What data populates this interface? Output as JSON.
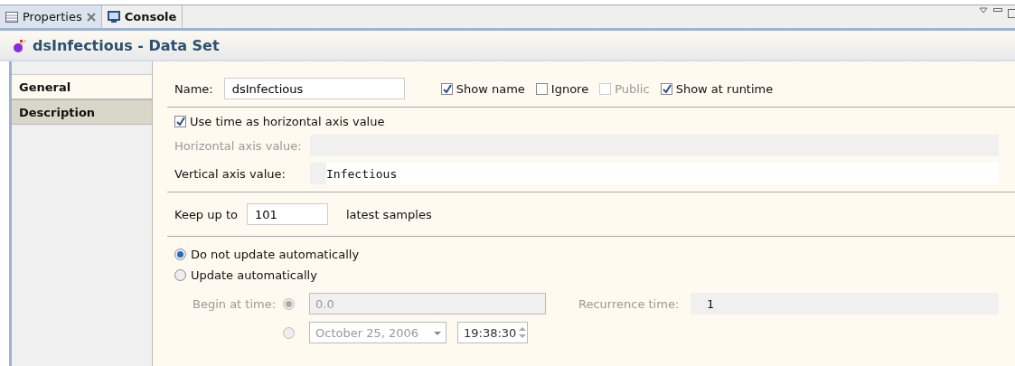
{
  "tabs": [
    {
      "label": "Properties",
      "selected": true,
      "closable": true,
      "kind": "properties"
    },
    {
      "label": "Console",
      "selected": false,
      "closable": false,
      "kind": "console"
    }
  ],
  "header": {
    "title": "dsInfectious - Data Set"
  },
  "sidebar": {
    "items": [
      {
        "label": "General",
        "selected": true
      },
      {
        "label": "Description",
        "selected": false
      }
    ]
  },
  "name_row": {
    "label": "Name:",
    "value": "dsInfectious",
    "options": [
      {
        "label": "Show name",
        "checked": true,
        "disabled": false
      },
      {
        "label": "Ignore",
        "checked": false,
        "disabled": false
      },
      {
        "label": "Public",
        "checked": false,
        "disabled": true
      },
      {
        "label": "Show at runtime",
        "checked": true,
        "disabled": false
      }
    ]
  },
  "axis": {
    "use_time": {
      "label": "Use time as horizontal axis value",
      "checked": true
    },
    "horizontal": {
      "label": "Horizontal axis value:",
      "disabled": true
    },
    "vertical": {
      "label": "Vertical axis value:",
      "value": "Infectious",
      "disabled": false
    }
  },
  "samples": {
    "label": "Keep up to",
    "value": "101",
    "suffix": "latest samples"
  },
  "update": {
    "modes": [
      {
        "label": "Do not update automatically",
        "selected": true
      },
      {
        "label": "Update automatically",
        "selected": false
      }
    ],
    "begin_label": "Begin at time:",
    "begin_options": [
      {
        "selected": true
      },
      {
        "selected": false
      }
    ],
    "begin_value": "0.0",
    "recurrence_label": "Recurrence time:",
    "recurrence_value": "1",
    "date": "October 25, 2006",
    "time": "19:38:30"
  }
}
